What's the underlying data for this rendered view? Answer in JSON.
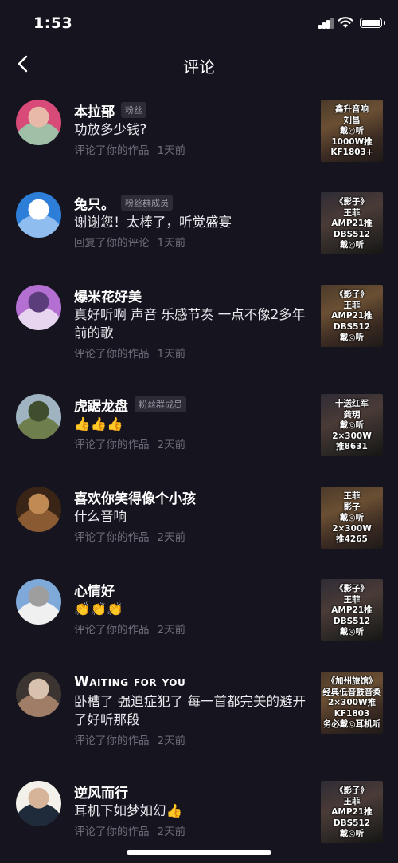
{
  "status": {
    "time": "1:53"
  },
  "nav": {
    "title": "评论"
  },
  "comments": [
    {
      "name": "本拉郚",
      "badge": "粉丝",
      "text": "功放多少钱?",
      "action": "评论了你的作品",
      "time": "1天前",
      "thumb": "鑫升音响\n刘昌\n戴◎听\n1000W推\nKF1803+",
      "avatar_colors": [
        "#d84a78",
        "#9fc0a6",
        "#e8b9a8"
      ]
    },
    {
      "name": "兔只。",
      "badge": "粉丝群成员",
      "text": "谢谢您！太棒了，听觉盛宴",
      "action": "回复了你的评论",
      "time": "1天前",
      "thumb": "《影子》\n王菲\nAMP21推\nDBS512\n戴◎听",
      "avatar_colors": [
        "#2d7ed8",
        "#8fbdef",
        "#ffffff"
      ]
    },
    {
      "name": "爆米花好美",
      "badge": "",
      "text": "真好听啊 声音 乐感节奏 一点不像2多年前的歌",
      "action": "评论了你的作品",
      "time": "1天前",
      "thumb": "《影子》\n王菲\nAMP21推\nDBS512\n戴◎听",
      "avatar_colors": [
        "#b36fd1",
        "#e7d5ef",
        "#5a3d7a"
      ]
    },
    {
      "name": "虎踞龙盘",
      "badge": "粉丝群成员",
      "text": "👍👍👍",
      "action": "评论了你的作品",
      "time": "2天前",
      "thumb": "十送红军\n龚玥\n戴◎听\n2×300W\n推8631",
      "avatar_colors": [
        "#9fb3c1",
        "#6e7f4d",
        "#3f4e2c"
      ]
    },
    {
      "name": "喜欢你笑得像个小孩",
      "badge": "",
      "text": "什么音响",
      "action": "评论了你的作品",
      "time": "2天前",
      "thumb": "王菲\n影子\n戴◎听\n2×300W\n推4265",
      "avatar_colors": [
        "#3a2416",
        "#8a5a33",
        "#c08a55"
      ]
    },
    {
      "name": "心情好",
      "badge": "",
      "text": "👏👏👏",
      "action": "评论了你的作品",
      "time": "2天前",
      "thumb": "《影子》\n王菲\nAMP21推\nDBS512\n戴◎听",
      "avatar_colors": [
        "#7ea9d8",
        "#f0f0f0",
        "#9e9e9e"
      ]
    },
    {
      "name": "Waiting for you",
      "badge": "",
      "text": "卧槽了 强迫症犯了 每一首都完美的避开了好听那段",
      "action": "评论了你的作品",
      "time": "2天前",
      "thumb": "《加州旅馆》\n经典低音鼓音柔\n2×300W推KF1803\n务必戴◎耳机听",
      "avatar_colors": [
        "#3b3431",
        "#a07d67",
        "#d8c2ad"
      ]
    },
    {
      "name": "逆风而行",
      "badge": "",
      "text": "耳机下如梦如幻👍",
      "action": "评论了你的作品",
      "time": "2天前",
      "thumb": "《影子》\n王菲\nAMP21推\nDBS512\n戴◎听",
      "avatar_colors": [
        "#f4f1ea",
        "#1f2a3a",
        "#d6b49a"
      ]
    }
  ]
}
